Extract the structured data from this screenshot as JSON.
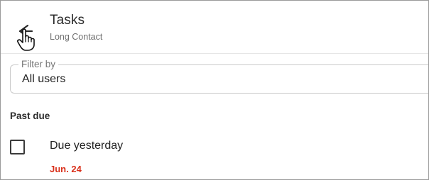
{
  "header": {
    "title": "Tasks",
    "subtitle": "Long Contact",
    "back_icon": "back-arrow-icon",
    "cursor_icon": "hand-pointer-icon"
  },
  "filter": {
    "label": "Filter by",
    "value": "All users"
  },
  "sections": [
    {
      "title": "Past due",
      "tasks": [
        {
          "title": "Due yesterday",
          "due": "Jun. 24",
          "checked": false
        }
      ]
    }
  ],
  "colors": {
    "due_text": "#d9301b",
    "primary_text": "#222222",
    "secondary_text": "#6f6f6f",
    "border": "#c9c9c9"
  }
}
